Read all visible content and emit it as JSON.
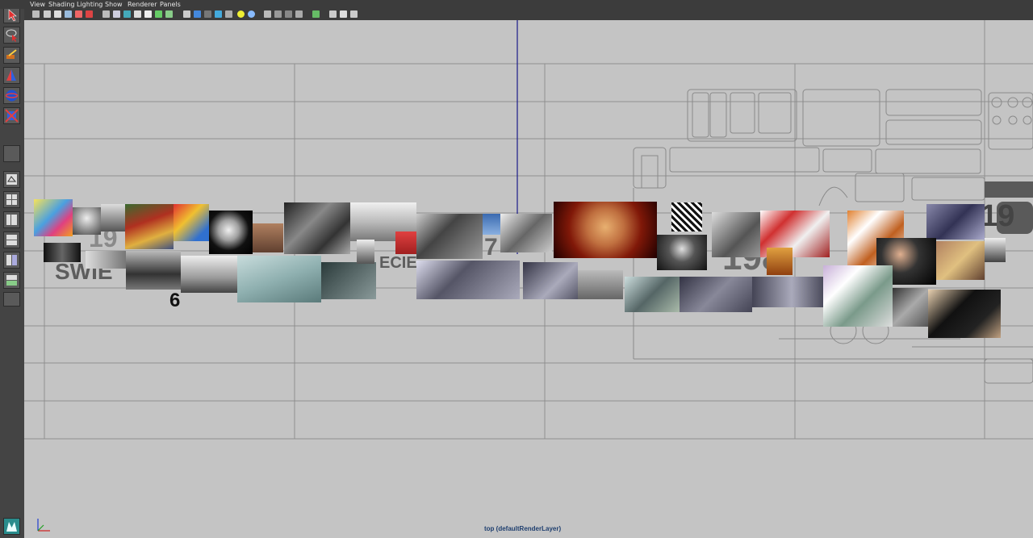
{
  "app": {
    "menus": [
      "View",
      "Shading",
      "Lighting",
      "Show",
      "Renderer",
      "Panels"
    ]
  },
  "toolbox": {
    "tools": [
      "select-tool",
      "lasso-tool",
      "paint-tool",
      "move-tool",
      "rotate-tool",
      "scale-tool",
      "last-tool",
      "single-layout",
      "four-layout",
      "side-layout",
      "stacked-layout",
      "persp-graph-layout",
      "hypershade-layout",
      "outliner-layout"
    ]
  },
  "viewport": {
    "camera_label": "top (defaultRenderLayer)",
    "overlay_text": {
      "swie": "SWIE",
      "ecie": "ECIE",
      "year_19": "19",
      "digit_7": "7",
      "digit_6": "6",
      "year_198": "198",
      "year_19_right": "19"
    }
  },
  "colors": {
    "background": "#c4c4c4",
    "toolbar": "#3c3c3c",
    "camera_line": "#1a1a8a",
    "label": "#1f3f6f"
  }
}
